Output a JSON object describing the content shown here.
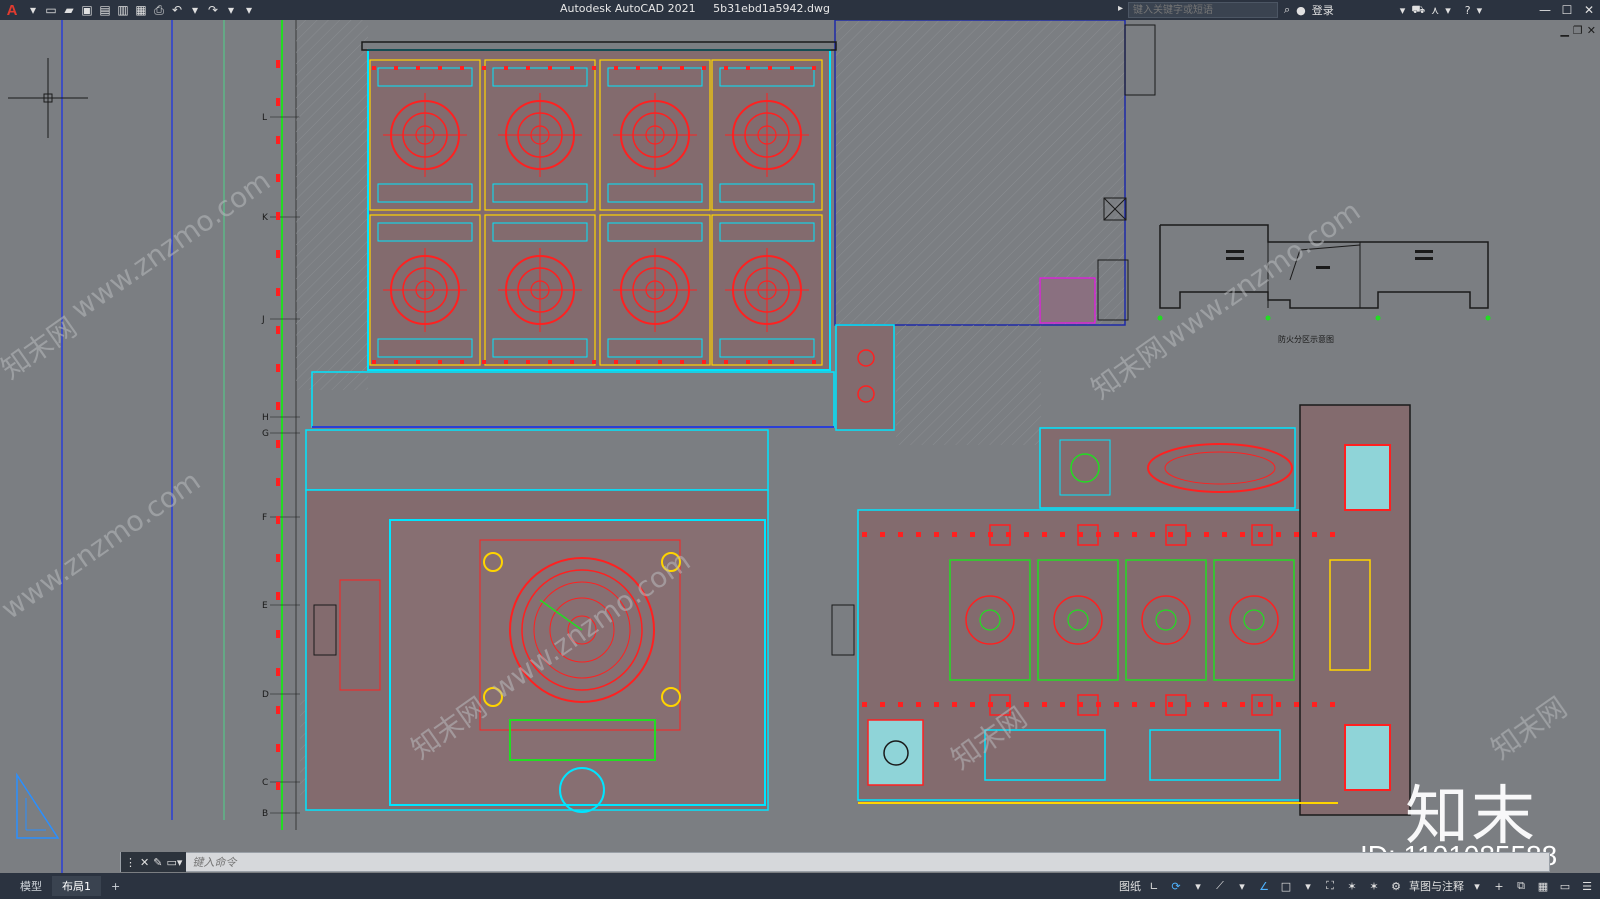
{
  "app": {
    "logo": "A",
    "product": "Autodesk AutoCAD 2021",
    "filename": "5b31ebd1a5942.dwg"
  },
  "search": {
    "placeholder": "键入关键字或短语"
  },
  "account": {
    "login_label": "登录"
  },
  "quick_access": [
    {
      "name": "new-icon",
      "glyph": "▭"
    },
    {
      "name": "open-icon",
      "glyph": "📂"
    },
    {
      "name": "save-icon",
      "glyph": "💾"
    },
    {
      "name": "saveas-icon",
      "glyph": "🖫"
    },
    {
      "name": "publish-icon",
      "glyph": "▤"
    },
    {
      "name": "plot-preview-icon",
      "glyph": "▦"
    },
    {
      "name": "print-icon",
      "glyph": "⎙"
    },
    {
      "name": "undo-icon",
      "glyph": "↶"
    },
    {
      "name": "redo-icon",
      "glyph": "↷"
    },
    {
      "name": "customize-icon",
      "glyph": "▾"
    }
  ],
  "drawing": {
    "grid_labels": [
      "L",
      "K",
      "J",
      "H",
      "G",
      "F",
      "E",
      "D",
      "C",
      "B"
    ],
    "fire_zone_label": "防火分区示意图",
    "watermark_site": "www.znzmo.com",
    "watermark_brand": "知末网"
  },
  "watermark": {
    "logo": "知末",
    "id": "ID: 1101085588"
  },
  "command": {
    "placeholder": "键入命令"
  },
  "layout_tabs": [
    {
      "label": "模型",
      "active": false
    },
    {
      "label": "布局1",
      "active": true
    },
    {
      "label": "+",
      "active": false
    }
  ],
  "status": {
    "paper_label": "图纸",
    "workspace_label": "草图与注释"
  },
  "colors": {
    "canvas_bg": "#7b7e82",
    "titlebar_bg": "#2b3340",
    "accent_red": "#ff2020",
    "accent_cyan": "#00e5ff",
    "accent_green": "#22dd22"
  }
}
